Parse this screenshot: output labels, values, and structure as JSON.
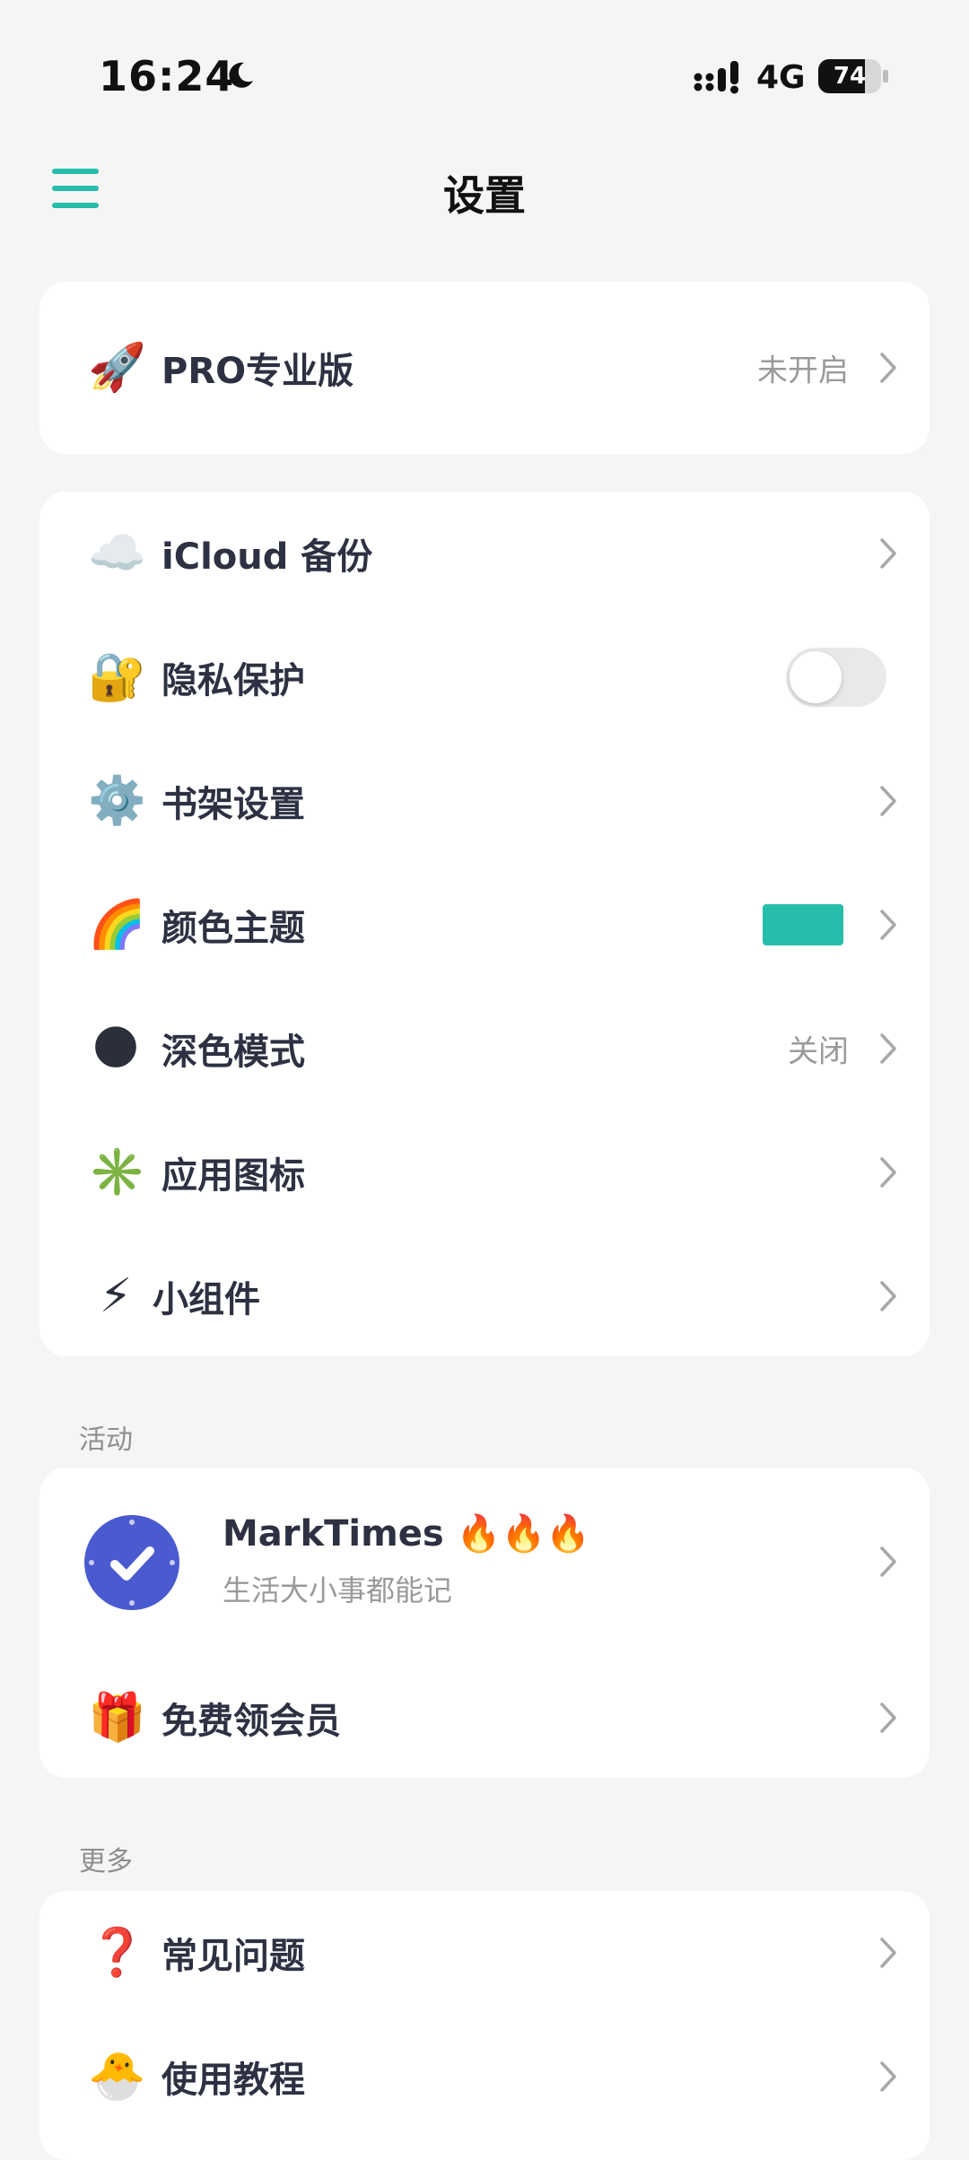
{
  "status_bar": {
    "time": "16:24",
    "network": "4G",
    "battery_level": "74",
    "battery_fraction": 0.74
  },
  "header": {
    "title": "设置",
    "menu_icon": "hamburger-menu-icon",
    "accent_color": "#26bdaa"
  },
  "pro_card": {
    "icon": "🚀",
    "label": "PRO专业版",
    "value": "未开启"
  },
  "settings_card": {
    "items": [
      {
        "icon": "☁️",
        "label": "iCloud 备份",
        "value": ""
      },
      {
        "icon": "🔐",
        "label": "隐私保护",
        "toggle_on": false
      },
      {
        "icon": "⚙️",
        "label": "书架设置",
        "value": ""
      },
      {
        "icon": "🌈",
        "label": "颜色主题",
        "swatch_color": "#26bdaa"
      },
      {
        "icon": "🌑",
        "label": "深色模式",
        "value": "关闭"
      },
      {
        "icon": "✳️",
        "label": "应用图标",
        "value": ""
      },
      {
        "icon": "⚡",
        "label": "小组件",
        "value": ""
      }
    ]
  },
  "activity_section": {
    "title": "活动",
    "app": {
      "name": "MarkTimes 🔥🔥🔥",
      "subtitle": "生活大小事都能记",
      "logo_color": "#4a5bd0"
    },
    "gift": {
      "icon": "🎁",
      "label": "免费领会员"
    }
  },
  "more_section": {
    "title": "更多",
    "items": [
      {
        "icon": "❓",
        "label": "常见问题"
      },
      {
        "icon": "🐣",
        "label": "使用教程"
      }
    ]
  }
}
